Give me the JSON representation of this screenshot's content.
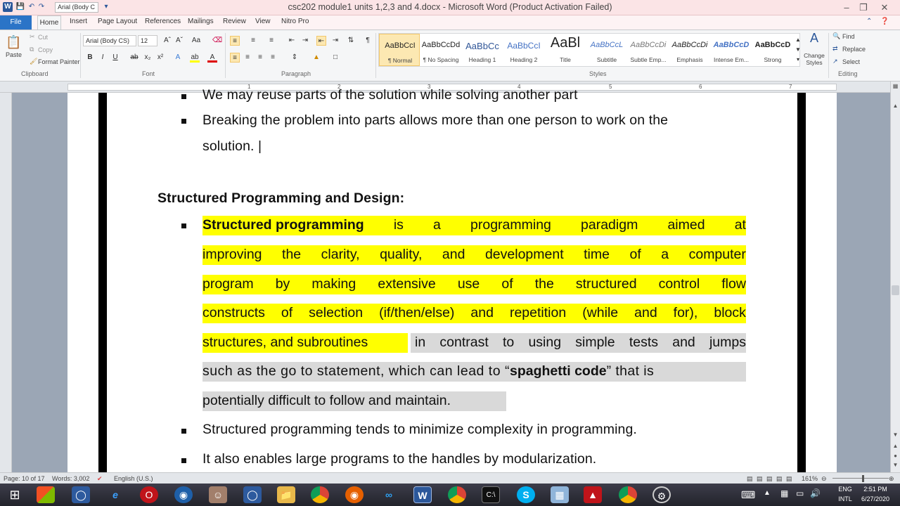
{
  "window": {
    "title": "csc202 module1 units 1,2,3 and 4.docx - Microsoft Word (Product Activation Failed)",
    "qat_font": "Arial (Body C"
  },
  "tabs": [
    "File",
    "Home",
    "Insert",
    "Page Layout",
    "References",
    "Mailings",
    "Review",
    "View",
    "Nitro Pro"
  ],
  "ribbon": {
    "clipboard": {
      "paste": "Paste",
      "cut": "Cut",
      "copy": "Copy",
      "format_painter": "Format Painter",
      "label": "Clipboard"
    },
    "font": {
      "family": "Arial (Body CS)",
      "size": "12",
      "label": "Font"
    },
    "paragraph": {
      "label": "Paragraph"
    },
    "styles": {
      "label": "Styles",
      "items": [
        {
          "preview": "AaBbCcI",
          "name": "¶ Normal"
        },
        {
          "preview": "AaBbCcDd",
          "name": "¶ No Spacing"
        },
        {
          "preview": "AaBbCc",
          "name": "Heading 1"
        },
        {
          "preview": "AaBbCcI",
          "name": "Heading 2"
        },
        {
          "preview": "AaBl",
          "name": "Title"
        },
        {
          "preview": "AaBbCcL",
          "name": "Subtitle"
        },
        {
          "preview": "AaBbCcDi",
          "name": "Subtle Emp..."
        },
        {
          "preview": "AaBbCcDi",
          "name": "Emphasis"
        },
        {
          "preview": "AaBbCcD",
          "name": "Intense Em..."
        },
        {
          "preview": "AaBbCcD",
          "name": "Strong"
        }
      ],
      "change_styles": "Change Styles"
    },
    "editing": {
      "find": "Find",
      "replace": "Replace",
      "select": "Select",
      "label": "Editing"
    }
  },
  "ruler": [
    "1",
    "2",
    "3",
    "4",
    "5",
    "6",
    "7"
  ],
  "document": {
    "line_top": "We  may reuse parts of the solution while solving another part",
    "bullet2_line1": "Breaking the problem into parts allows more than one person to work on the",
    "bullet2_line2": "solution. |",
    "heading": "Structured Programming and Design:",
    "p1": {
      "bold_term": "Structured programming",
      "l1_rest": [
        "is",
        "a",
        "programming",
        "paradigm",
        "aimed",
        "at"
      ],
      "l2": [
        "improving",
        "the",
        "clarity,",
        "quality,",
        "and",
        "development",
        "time",
        "of",
        "a",
        "computer"
      ],
      "l3": [
        "program",
        "by",
        "making",
        "extensive",
        "use",
        "of",
        "the",
        "structured",
        "control",
        "flow"
      ],
      "l4": [
        "constructs",
        "of",
        "selection",
        "(if/then/else)",
        "and",
        "repetition",
        "(while",
        "and",
        "for),",
        "block"
      ],
      "l5_yellow": "structures, and subroutines",
      "l5_grey": [
        "in",
        "contrast",
        "to",
        "using",
        "simple",
        "tests",
        "and",
        "jumps"
      ],
      "l6_a": "such as the go to statement, which can lead to “",
      "l6_bold": "spaghetti code",
      "l6_b": "” that is",
      "l7": "potentially difficult to follow and maintain."
    },
    "bullet4": "Structured programming tends to minimize complexity in programming.",
    "bullet5": "It also enables large programs to the handles by modularization."
  },
  "status": {
    "page": "Page: 10 of 17",
    "words": "Words: 3,002",
    "language": "English (U.S.)",
    "zoom": "161%"
  },
  "tray": {
    "lang": "ENG",
    "layout": "INTL",
    "time": "2:51 PM",
    "date": "6/27/2020"
  }
}
